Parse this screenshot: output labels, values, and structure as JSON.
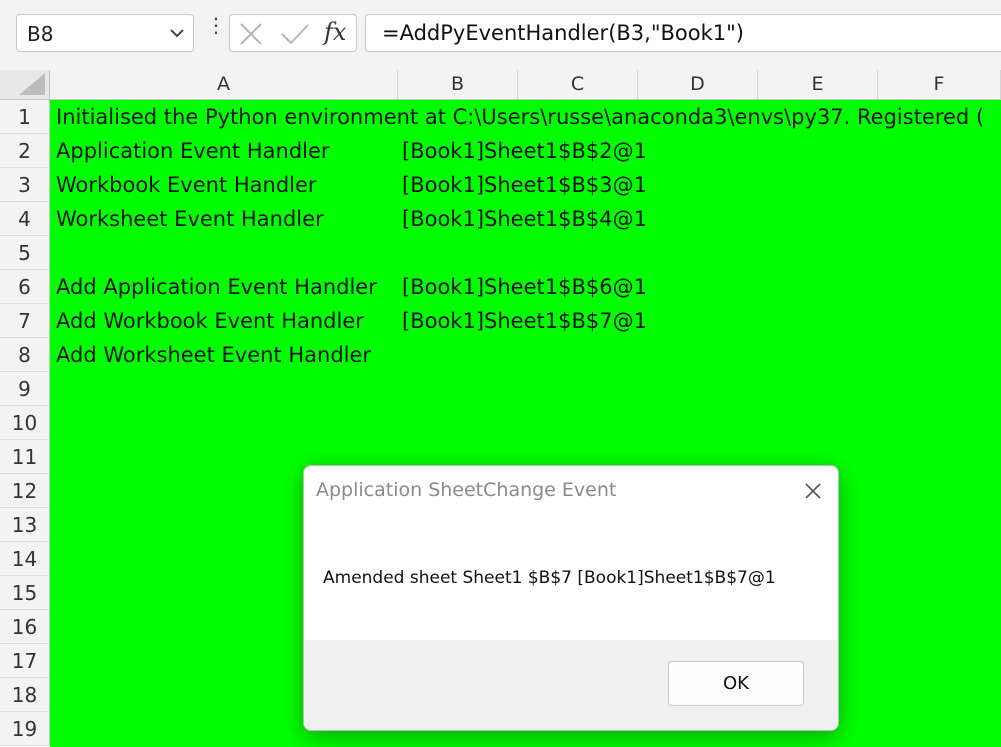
{
  "formula_bar": {
    "name_box": "B8",
    "fx_label": "fx",
    "formula": "=AddPyEventHandler(B3,\"Book1\")",
    "more_icon": "vertical-ellipsis-icon",
    "cancel_icon": "x-icon",
    "enter_icon": "check-icon"
  },
  "columns": [
    "A",
    "B",
    "C",
    "D",
    "E",
    "F"
  ],
  "rows": [
    "1",
    "2",
    "3",
    "4",
    "5",
    "6",
    "7",
    "8",
    "9",
    "10",
    "11",
    "12",
    "13",
    "14",
    "15",
    "16",
    "17",
    "18",
    "19"
  ],
  "cells": {
    "A1": "Initialised the Python environment at C:\\Users\\russe\\anaconda3\\envs\\py37. Registered (",
    "A2": "Application Event Handler",
    "B2": "[Book1]Sheet1$B$2@1",
    "A3": "Workbook Event Handler",
    "B3": "[Book1]Sheet1$B$3@1",
    "A4": "Worksheet Event Handler",
    "B4": "[Book1]Sheet1$B$4@1",
    "A6": "Add Application Event Handler",
    "B6": "[Book1]Sheet1$B$6@1",
    "A7": "Add Workbook Event Handler",
    "B7": "[Book1]Sheet1$B$7@1",
    "A8": "Add Worksheet Event Handler"
  },
  "sheet_fill_color": "#00ff00",
  "dialog": {
    "title": "Application SheetChange Event",
    "message": "Amended sheet Sheet1 $B$7 [Book1]Sheet1$B$7@1",
    "ok_label": "OK",
    "close_icon": "close-icon"
  }
}
